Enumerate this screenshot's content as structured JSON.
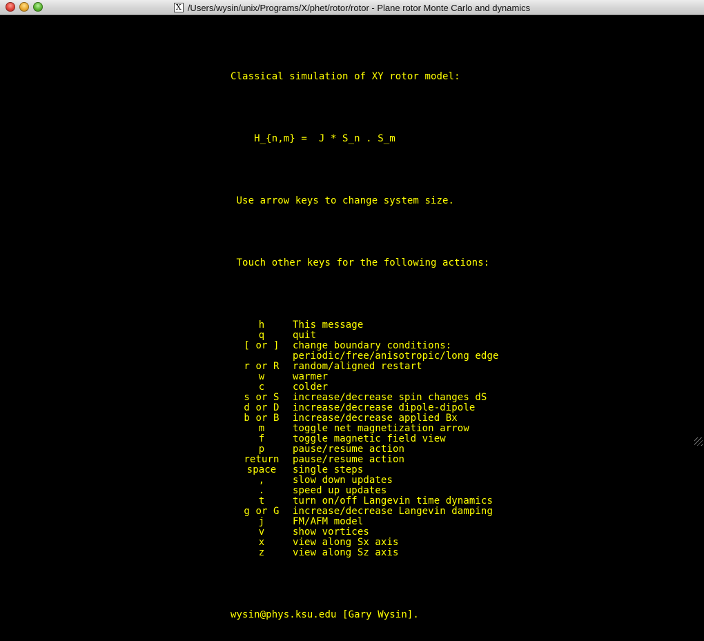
{
  "window": {
    "title": "/Users/wysin/unix/Programs/X/phet/rotor/rotor - Plane rotor Monte Carlo and dynamics",
    "app_icon": "X"
  },
  "terminal": {
    "heading": "Classical simulation of XY rotor model:",
    "hamiltonian": "    H_{n,m} =  J * S_n . S_m",
    "arrow_msg": " Use arrow keys to change system size.",
    "touch_msg": " Touch other keys for the following actions:",
    "commands": [
      {
        "key": "h",
        "desc": "This message"
      },
      {
        "key": "q",
        "desc": "quit"
      },
      {
        "key": "[ or ]",
        "desc": "change boundary conditions:"
      },
      {
        "key": "",
        "desc": "periodic/free/anisotropic/long edge"
      },
      {
        "key": "r or R",
        "desc": "random/aligned restart"
      },
      {
        "key": "w",
        "desc": "warmer"
      },
      {
        "key": "c",
        "desc": "colder"
      },
      {
        "key": "s or S",
        "desc": "increase/decrease spin changes dS"
      },
      {
        "key": "d or D",
        "desc": "increase/decrease dipole-dipole"
      },
      {
        "key": "b or B",
        "desc": "increase/decrease applied Bx"
      },
      {
        "key": "m",
        "desc": "toggle net magnetization arrow"
      },
      {
        "key": "f",
        "desc": "toggle magnetic field view"
      },
      {
        "key": "p",
        "desc": "pause/resume action"
      },
      {
        "key": "return",
        "desc": "pause/resume action"
      },
      {
        "key": "space",
        "desc": "single steps"
      },
      {
        "key": ",",
        "desc": "slow down updates"
      },
      {
        "key": ".",
        "desc": "speed up updates"
      },
      {
        "key": "t",
        "desc": "turn on/off Langevin time dynamics"
      },
      {
        "key": "g or G",
        "desc": "increase/decrease Langevin damping"
      },
      {
        "key": "j",
        "desc": "FM/AFM model"
      },
      {
        "key": "v",
        "desc": "show vortices"
      },
      {
        "key": "x",
        "desc": "view along Sx axis"
      },
      {
        "key": "z",
        "desc": "view along Sz axis"
      }
    ],
    "footer": "wysin@phys.ksu.edu [Gary Wysin]."
  },
  "colors": {
    "text": "#ffff00",
    "background": "#000000"
  }
}
